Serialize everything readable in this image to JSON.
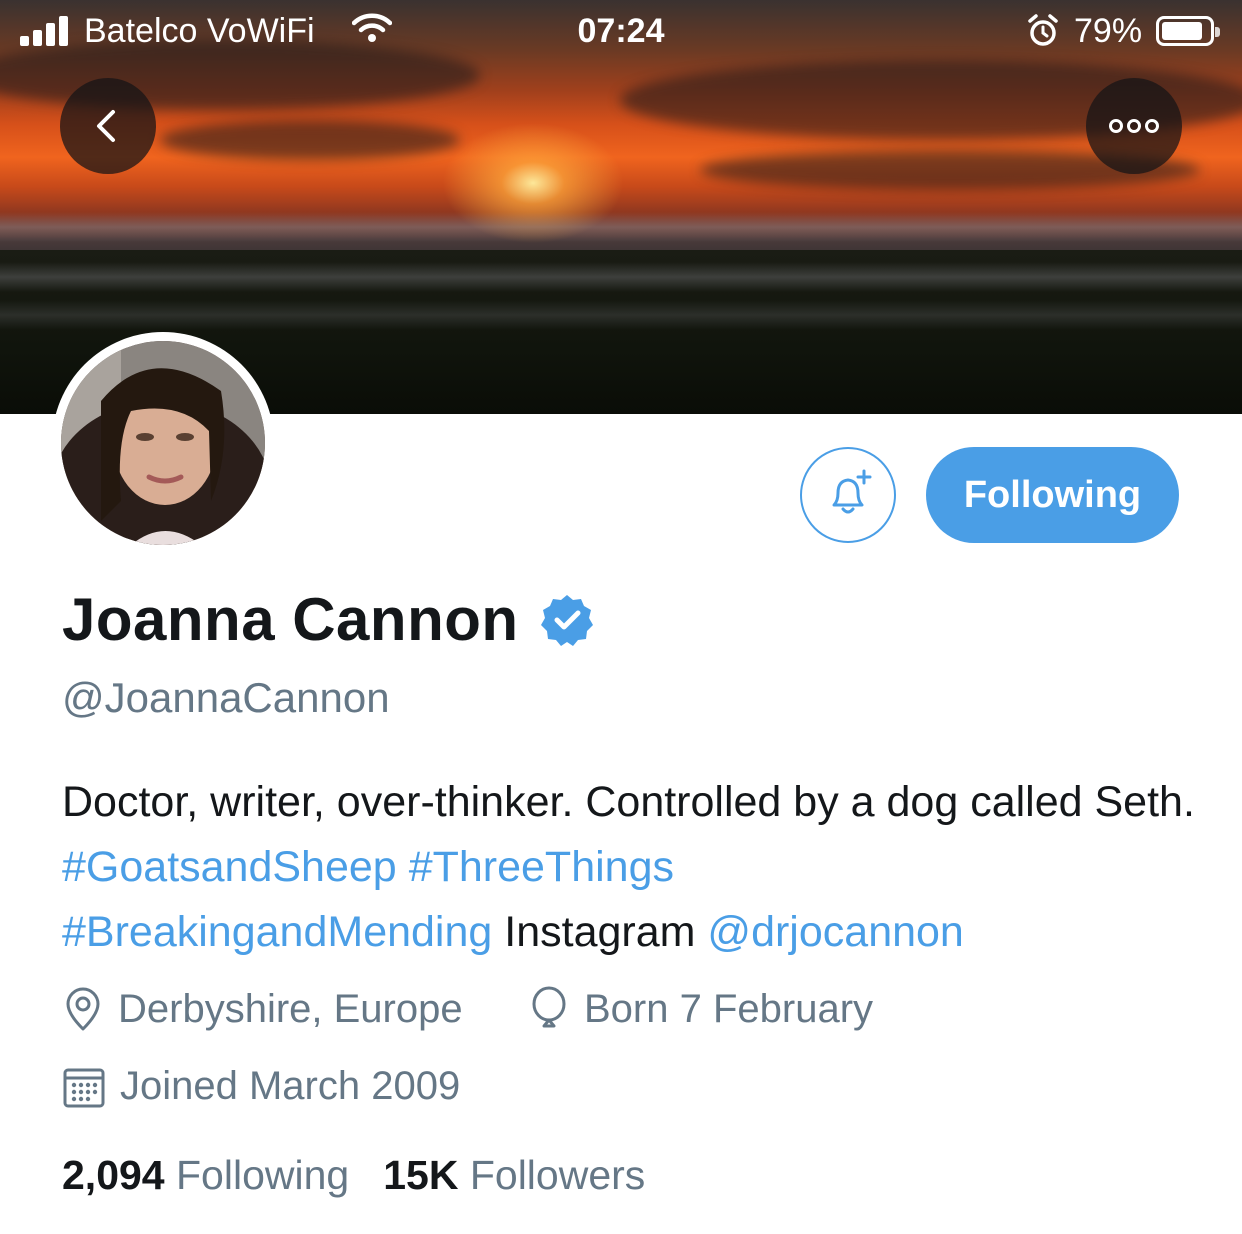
{
  "status_bar": {
    "carrier": "Batelco VoWiFi",
    "time": "07:24",
    "battery_percent": "79%",
    "signal_icon": "signal-bars-icon",
    "wifi_icon": "wifi-icon",
    "alarm_icon": "alarm-clock-icon",
    "battery_icon": "battery-icon",
    "battery_level": 0.79
  },
  "header": {
    "back_icon": "chevron-left-icon",
    "more_icon": "more-dots-icon"
  },
  "profile": {
    "name": "Joanna Cannon",
    "verified_icon": "verified-badge-icon",
    "handle": "@JoannaCannon",
    "bio": [
      {
        "text": "Doctor, writer, over-thinker. Controlled by a dog called Seth. ",
        "link": false
      },
      {
        "text": "#GoatsandSheep",
        "link": true
      },
      {
        "text": " ",
        "link": false
      },
      {
        "text": "#ThreeThings",
        "link": true
      },
      {
        "text": " ",
        "link": false
      },
      {
        "text": "#BreakingandMending",
        "link": true
      },
      {
        "text": " Instagram ",
        "link": false
      },
      {
        "text": "@drjocannon",
        "link": true
      }
    ],
    "location": "Derbyshire, Europe",
    "birthday": "Born 7 February",
    "joined": "Joined March 2009",
    "following_count": "2,094",
    "following_label": "Following",
    "followers_count": "15K",
    "followers_label": "Followers"
  },
  "actions": {
    "notify_icon": "bell-plus-icon",
    "follow_button_label": "Following"
  },
  "colors": {
    "accent": "#4a9ee6",
    "secondary_text": "#657786",
    "primary_text": "#14171a"
  }
}
